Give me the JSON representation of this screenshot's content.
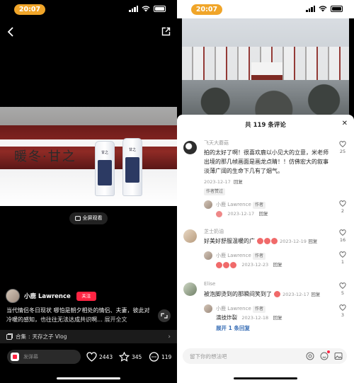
{
  "status_bar": {
    "time": "20:07"
  },
  "left": {
    "fullscreen_label": "全屏观看",
    "video_overlay_text": "暖冬·甘之",
    "bottle_brand": "甘之",
    "author": {
      "name": "小鹿 Lawrence",
      "follow_label": "关注"
    },
    "description": "当代情侣冬日现状 哪怕是朝夕相处的情侣、夫妻，彼此对冷暖的感知，也往往无法达成共识啊…",
    "expand_label": "展开全文",
    "collection": {
      "prefix": "合集",
      "title": "天存之子 Vlog"
    },
    "danmu_placeholder": "发弹幕",
    "stats": {
      "likes": "2443",
      "stars": "345",
      "comments": "119"
    }
  },
  "right": {
    "sheet_title": "共 119 条评论",
    "comments": [
      {
        "user": "飞天大蘑菇",
        "text": "拍的太好了啊！很喜欢鹿以小见大的立意，米老师出境的那几帧画面是画龙点睛！！仿佛宏大的叙事淡薄广阔的生命下几有了烟气。",
        "date": "2023-12-17",
        "reply_label": "回复",
        "tag": "作者赞过",
        "likes": "25",
        "sub": {
          "user": "小鹿 Lawrence",
          "badge": "作者",
          "date": "2023-12-17",
          "reply_label": "回复",
          "likes": "2"
        }
      },
      {
        "user": "芝士奶油",
        "text": "好美好舒服温暖的广",
        "date": "2023-12-19",
        "reply_label": "回复",
        "likes": "16",
        "sub": {
          "user": "小鹿 Lawrence",
          "badge": "作者",
          "date": "2023-12-23",
          "reply_label": "回复",
          "likes": "1"
        }
      },
      {
        "user": "Elise",
        "text": "被泡脚烫到的那瞬间笑到了",
        "date": "2023-12-17",
        "reply_label": "回复",
        "likes": "5",
        "sub": {
          "user": "小鹿 Lawrence",
          "badge": "作者",
          "text": "演技炸裂",
          "date": "2023-12-18",
          "reply_label": "回复",
          "likes": "3"
        },
        "expand_label": "展开 1 条回复"
      }
    ],
    "input_placeholder": "留下你的想法吧"
  },
  "colors": {
    "accent": "#ff2442",
    "time_pill": "#f0a529",
    "link": "#3a6fb6"
  }
}
